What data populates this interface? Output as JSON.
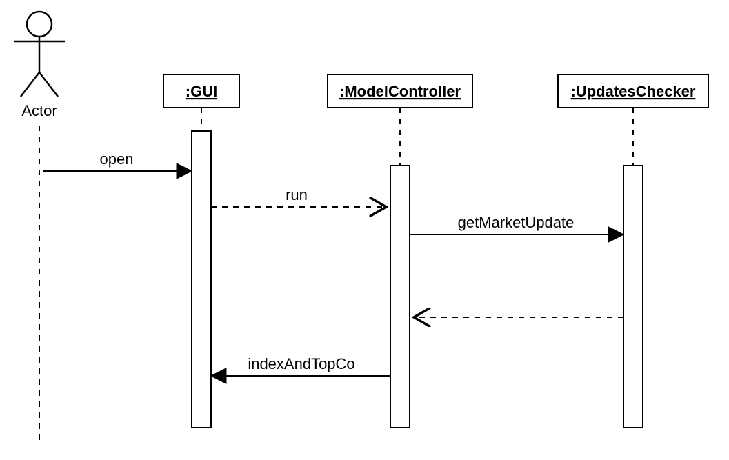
{
  "diagram": {
    "type": "uml-sequence",
    "actor": {
      "name": "Actor"
    },
    "lifelines": [
      {
        "id": "gui",
        "label": ":GUI"
      },
      {
        "id": "model",
        "label": ":ModelController"
      },
      {
        "id": "update",
        "label": ":UpdatesChecker"
      }
    ],
    "messages": [
      {
        "id": "m1",
        "from": "actor",
        "to": "gui",
        "label": "open",
        "style": "sync"
      },
      {
        "id": "m2",
        "from": "gui",
        "to": "model",
        "label": "run",
        "style": "async"
      },
      {
        "id": "m3",
        "from": "model",
        "to": "update",
        "label": "getMarketUpdate",
        "style": "sync"
      },
      {
        "id": "m4",
        "from": "update",
        "to": "model",
        "label": "",
        "style": "return"
      },
      {
        "id": "m5",
        "from": "model",
        "to": "gui",
        "label": "indexAndTopCo",
        "style": "sync"
      }
    ]
  }
}
